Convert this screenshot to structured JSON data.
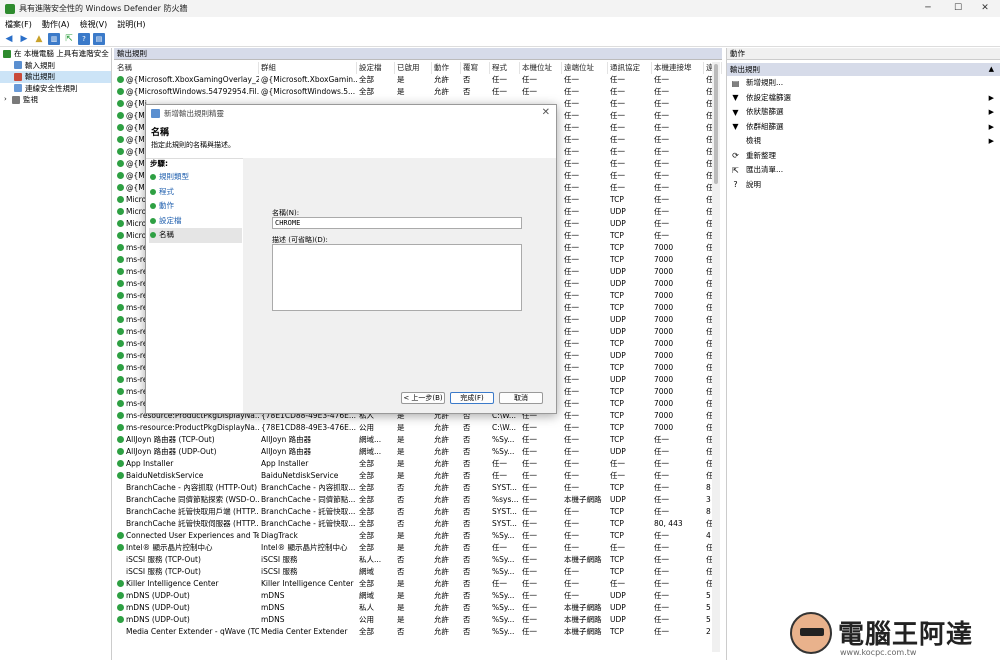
{
  "window": {
    "title": "具有進階安全性的 Windows Defender 防火牆",
    "minimize": "─",
    "maximize": "☐",
    "close": "✕"
  },
  "menu": [
    "檔案(F)",
    "動作(A)",
    "檢視(V)",
    "說明(H)"
  ],
  "tree": [
    {
      "label": "在 本機電腦 上具有進階安全",
      "level": 0,
      "selected": false
    },
    {
      "label": "輸入規則",
      "level": 1,
      "selected": false
    },
    {
      "label": "輸出規則",
      "level": 1,
      "selected": true
    },
    {
      "label": "連線安全性規則",
      "level": 1,
      "selected": false
    },
    {
      "label": "監視",
      "level": 1,
      "selected": false
    }
  ],
  "center": {
    "title": "輸出規則"
  },
  "columns": [
    "名稱",
    "群組",
    "設定檔",
    "已啟用",
    "動作",
    "覆寫",
    "程式",
    "本機位址",
    "遠端位址",
    "通訊協定",
    "本機連接埠",
    "遠"
  ],
  "rows": [
    {
      "on": true,
      "c": [
        "@{Microsoft.XboxGamingOverlay_2...",
        "@{Microsoft.XboxGamin...",
        "全部",
        "是",
        "允許",
        "否",
        "任一",
        "任一",
        "任一",
        "任一",
        "任一",
        "任"
      ]
    },
    {
      "on": true,
      "c": [
        "@{MicrosoftWindows.54792954.Fil...",
        "@{MicrosoftWindows.5...",
        "全部",
        "是",
        "允許",
        "否",
        "任一",
        "任一",
        "任一",
        "任一",
        "任一",
        "任"
      ]
    },
    {
      "on": true,
      "c": [
        "@{Mi",
        "",
        "",
        "",
        "",
        "",
        "",
        "",
        "任一",
        "任一",
        "任一",
        "任"
      ]
    },
    {
      "on": true,
      "c": [
        "@{Mi",
        "",
        "",
        "",
        "",
        "",
        "",
        "",
        "任一",
        "任一",
        "任一",
        "任"
      ]
    },
    {
      "on": true,
      "c": [
        "@{Mi",
        "",
        "",
        "",
        "",
        "",
        "",
        "",
        "任一",
        "任一",
        "任一",
        "任"
      ]
    },
    {
      "on": true,
      "c": [
        "@{Mi",
        "",
        "",
        "",
        "",
        "",
        "",
        "",
        "任一",
        "任一",
        "任一",
        "任"
      ]
    },
    {
      "on": true,
      "c": [
        "@{Mi",
        "",
        "",
        "",
        "",
        "",
        "",
        "",
        "任一",
        "任一",
        "任一",
        "任"
      ]
    },
    {
      "on": true,
      "c": [
        "@{Mi",
        "",
        "",
        "",
        "",
        "",
        "",
        "",
        "任一",
        "任一",
        "任一",
        "任"
      ]
    },
    {
      "on": true,
      "c": [
        "@{Mi",
        "",
        "",
        "",
        "",
        "",
        "",
        "",
        "任一",
        "任一",
        "任一",
        "任"
      ]
    },
    {
      "on": true,
      "c": [
        "@{Mi",
        "",
        "",
        "",
        "",
        "",
        "",
        "",
        "任一",
        "任一",
        "任一",
        "任"
      ]
    },
    {
      "on": true,
      "c": [
        "Micro",
        "",
        "",
        "",
        "",
        "",
        "",
        "",
        "任一",
        "TCP",
        "任一",
        "任"
      ]
    },
    {
      "on": true,
      "c": [
        "Micro",
        "",
        "",
        "",
        "",
        "",
        "",
        "",
        "任一",
        "UDP",
        "任一",
        "任"
      ]
    },
    {
      "on": true,
      "c": [
        "Micro",
        "",
        "",
        "",
        "",
        "",
        "",
        "",
        "任一",
        "UDP",
        "任一",
        "任"
      ]
    },
    {
      "on": true,
      "c": [
        "Micro",
        "",
        "",
        "",
        "",
        "",
        "",
        "",
        "任一",
        "TCP",
        "任一",
        "任"
      ]
    },
    {
      "on": true,
      "c": [
        "ms-re",
        "",
        "",
        "",
        "",
        "",
        "",
        "",
        "任一",
        "TCP",
        "7000",
        "任"
      ]
    },
    {
      "on": true,
      "c": [
        "ms-re",
        "",
        "",
        "",
        "",
        "",
        "",
        "",
        "任一",
        "TCP",
        "7000",
        "任"
      ]
    },
    {
      "on": true,
      "c": [
        "ms-re",
        "",
        "",
        "",
        "",
        "",
        "",
        "",
        "任一",
        "UDP",
        "7000",
        "任"
      ]
    },
    {
      "on": true,
      "c": [
        "ms-re",
        "",
        "",
        "",
        "",
        "",
        "",
        "",
        "任一",
        "UDP",
        "7000",
        "任"
      ]
    },
    {
      "on": true,
      "c": [
        "ms-re",
        "",
        "",
        "",
        "",
        "",
        "",
        "",
        "任一",
        "TCP",
        "7000",
        "任"
      ]
    },
    {
      "on": true,
      "c": [
        "ms-re",
        "",
        "",
        "",
        "",
        "",
        "",
        "",
        "任一",
        "TCP",
        "7000",
        "任"
      ]
    },
    {
      "on": true,
      "c": [
        "ms-re",
        "",
        "",
        "",
        "",
        "",
        "",
        "",
        "任一",
        "UDP",
        "7000",
        "任"
      ]
    },
    {
      "on": true,
      "c": [
        "ms-re",
        "",
        "",
        "",
        "",
        "",
        "",
        "",
        "任一",
        "UDP",
        "7000",
        "任"
      ]
    },
    {
      "on": true,
      "c": [
        "ms-re",
        "",
        "",
        "",
        "",
        "",
        "",
        "",
        "任一",
        "TCP",
        "7000",
        "任"
      ]
    },
    {
      "on": true,
      "c": [
        "ms-re",
        "",
        "",
        "",
        "",
        "",
        "",
        "",
        "任一",
        "UDP",
        "7000",
        "任"
      ]
    },
    {
      "on": true,
      "c": [
        "ms-re",
        "",
        "",
        "",
        "",
        "",
        "",
        "",
        "任一",
        "TCP",
        "7000",
        "任"
      ]
    },
    {
      "on": true,
      "c": [
        "ms-re",
        "",
        "",
        "",
        "",
        "",
        "",
        "",
        "任一",
        "UDP",
        "7000",
        "任"
      ]
    },
    {
      "on": true,
      "c": [
        "ms-re",
        "",
        "",
        "",
        "",
        "",
        "",
        "",
        "任一",
        "TCP",
        "7000",
        "任"
      ]
    },
    {
      "on": true,
      "c": [
        "ms-re",
        "",
        "",
        "",
        "",
        "",
        "",
        "",
        "任一",
        "TCP",
        "7000",
        "任"
      ]
    },
    {
      "on": true,
      "c": [
        "ms-resource:ProductPkgDisplayNa...",
        "{78E1CD88-49E3-476E...",
        "私人",
        "是",
        "允許",
        "否",
        "C:\\W...",
        "任一",
        "任一",
        "TCP",
        "7000",
        "任"
      ]
    },
    {
      "on": true,
      "c": [
        "ms-resource:ProductPkgDisplayNa...",
        "{78E1CD88-49E3-476E...",
        "公用",
        "是",
        "允許",
        "否",
        "C:\\W...",
        "任一",
        "任一",
        "TCP",
        "7000",
        "任"
      ]
    },
    {
      "on": true,
      "c": [
        "AllJoyn 路由器 (TCP-Out)",
        "AllJoyn 路由器",
        "網域...",
        "是",
        "允許",
        "否",
        "%Sy...",
        "任一",
        "任一",
        "TCP",
        "任一",
        "任"
      ]
    },
    {
      "on": true,
      "c": [
        "AllJoyn 路由器 (UDP-Out)",
        "AllJoyn 路由器",
        "網域...",
        "是",
        "允許",
        "否",
        "%Sy...",
        "任一",
        "任一",
        "UDP",
        "任一",
        "任"
      ]
    },
    {
      "on": true,
      "c": [
        "App Installer",
        "App Installer",
        "全部",
        "是",
        "允許",
        "否",
        "任一",
        "任一",
        "任一",
        "任一",
        "任一",
        "任"
      ]
    },
    {
      "on": true,
      "c": [
        "BaiduNetdiskService",
        "BaiduNetdiskService",
        "全部",
        "是",
        "允許",
        "否",
        "任一",
        "任一",
        "任一",
        "任一",
        "任一",
        "任"
      ]
    },
    {
      "on": false,
      "c": [
        "BranchCache - 內容抓取 (HTTP-Out)",
        "BranchCache - 內容抓取...",
        "全部",
        "否",
        "允許",
        "否",
        "SYST...",
        "任一",
        "任一",
        "TCP",
        "任一",
        "8"
      ]
    },
    {
      "on": false,
      "c": [
        "BranchCache 同儕節點探索 (WSD-O...",
        "BranchCache - 同儕節點...",
        "全部",
        "否",
        "允許",
        "否",
        "%sys...",
        "任一",
        "本機子網路",
        "UDP",
        "任一",
        "3"
      ]
    },
    {
      "on": false,
      "c": [
        "BranchCache 託管快取用戶端 (HTTP...",
        "BranchCache - 託管快取...",
        "全部",
        "否",
        "允許",
        "否",
        "SYST...",
        "任一",
        "任一",
        "TCP",
        "任一",
        "8"
      ]
    },
    {
      "on": false,
      "c": [
        "BranchCache 託管快取伺服器 (HTTP...",
        "BranchCache - 託管快取...",
        "全部",
        "否",
        "允許",
        "否",
        "SYST...",
        "任一",
        "任一",
        "TCP",
        "80, 443",
        "任"
      ]
    },
    {
      "on": true,
      "c": [
        "Connected User Experiences and Tel...",
        "DiagTrack",
        "全部",
        "是",
        "允許",
        "否",
        "%Sy...",
        "任一",
        "任一",
        "TCP",
        "任一",
        "4"
      ]
    },
    {
      "on": true,
      "c": [
        "Intel® 顯示晶片控制中心",
        "Intel® 顯示晶片控制中心",
        "全部",
        "是",
        "允許",
        "否",
        "任一",
        "任一",
        "任一",
        "任一",
        "任一",
        "任"
      ]
    },
    {
      "on": false,
      "c": [
        "iSCSI 服務 (TCP-Out)",
        "iSCSI 服務",
        "私人...",
        "否",
        "允許",
        "否",
        "%Sy...",
        "任一",
        "本機子網路",
        "TCP",
        "任一",
        "任"
      ]
    },
    {
      "on": false,
      "c": [
        "iSCSI 服務 (TCP-Out)",
        "iSCSI 服務",
        "網域",
        "否",
        "允許",
        "否",
        "%Sy...",
        "任一",
        "任一",
        "TCP",
        "任一",
        "任"
      ]
    },
    {
      "on": true,
      "c": [
        "Killer Intelligence Center",
        "Killer Intelligence Center",
        "全部",
        "是",
        "允許",
        "否",
        "任一",
        "任一",
        "任一",
        "任一",
        "任一",
        "任"
      ]
    },
    {
      "on": true,
      "c": [
        "mDNS (UDP-Out)",
        "mDNS",
        "網域",
        "是",
        "允許",
        "否",
        "%Sy...",
        "任一",
        "任一",
        "UDP",
        "任一",
        "5"
      ]
    },
    {
      "on": true,
      "c": [
        "mDNS (UDP-Out)",
        "mDNS",
        "私人",
        "是",
        "允許",
        "否",
        "%Sy...",
        "任一",
        "本機子網路",
        "UDP",
        "任一",
        "5"
      ]
    },
    {
      "on": true,
      "c": [
        "mDNS (UDP-Out)",
        "mDNS",
        "公用",
        "是",
        "允許",
        "否",
        "%Sy...",
        "任一",
        "本機子網路",
        "UDP",
        "任一",
        "5"
      ]
    },
    {
      "on": false,
      "c": [
        "Media Center Extender - qWave (TC...",
        "Media Center Extender",
        "全部",
        "否",
        "允許",
        "否",
        "%Sy...",
        "任一",
        "本機子網路",
        "TCP",
        "任一",
        "2"
      ]
    }
  ],
  "actions": {
    "header": "動作",
    "section": "輸出規則",
    "items": [
      {
        "label": "新增規則...",
        "icon": "new-rule-icon",
        "glyph": "▤",
        "arrow": false
      },
      {
        "label": "依設定檔篩選",
        "icon": "filter-icon",
        "glyph": "▼",
        "arrow": true
      },
      {
        "label": "依狀態篩選",
        "icon": "filter-icon",
        "glyph": "▼",
        "arrow": true
      },
      {
        "label": "依群組篩選",
        "icon": "filter-icon",
        "glyph": "▼",
        "arrow": true
      },
      {
        "label": "檢視",
        "icon": "",
        "glyph": "",
        "arrow": true
      },
      {
        "label": "重新整理",
        "icon": "refresh-icon",
        "glyph": "⟳",
        "arrow": false
      },
      {
        "label": "匯出清單...",
        "icon": "export-icon",
        "glyph": "⇱",
        "arrow": false
      },
      {
        "label": "說明",
        "icon": "help-icon",
        "glyph": "?",
        "arrow": false
      }
    ]
  },
  "dialog": {
    "title": "新增輸出規則精靈",
    "heading": "名稱",
    "subtitle": "指定此規則的名稱與描述。",
    "steps_header": "步驟:",
    "steps": [
      "規則類型",
      "程式",
      "動作",
      "設定檔",
      "名稱"
    ],
    "current_step": 4,
    "name_label": "名稱(N):",
    "name_value": "CHROME",
    "desc_label": "描述 (可省略)(D):",
    "desc_value": "",
    "back": "< 上一步(B)",
    "finish": "完成(F)",
    "cancel": "取消"
  },
  "watermark": {
    "brand": "電腦王阿達",
    "url": "www.kocpc.com.tw"
  },
  "colors": {
    "enabled": "#2ea043",
    "selection": "#cce4f7",
    "panel_header": "#d6dbe9"
  }
}
